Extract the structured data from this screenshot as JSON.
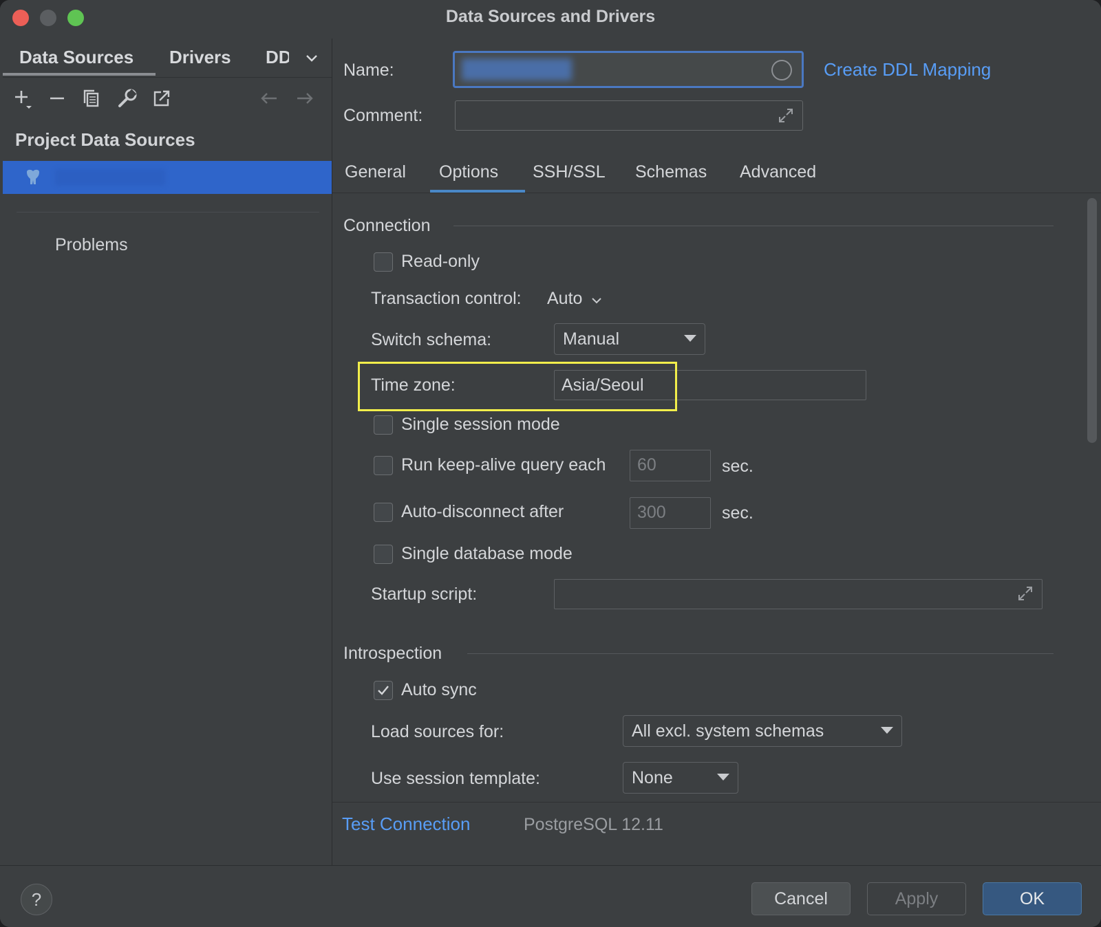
{
  "window": {
    "title": "Data Sources and Drivers"
  },
  "sidebar": {
    "tabs": [
      "Data Sources",
      "Drivers",
      "DD"
    ],
    "section_title": "Project Data Sources",
    "problems_label": "Problems"
  },
  "form": {
    "name_label": "Name:",
    "comment_label": "Comment:",
    "ddl_link": "Create DDL Mapping"
  },
  "tabs": [
    "General",
    "Options",
    "SSH/SSL",
    "Schemas",
    "Advanced"
  ],
  "connection": {
    "title": "Connection",
    "read_only": "Read-only",
    "transaction_label": "Transaction control:",
    "transaction_value": "Auto",
    "switch_schema_label": "Switch schema:",
    "switch_schema_value": "Manual",
    "time_zone_label": "Time zone:",
    "time_zone_value": "Asia/Seoul",
    "single_session": "Single session mode",
    "keep_alive": "Run keep-alive query each",
    "keep_alive_value": "60",
    "auto_disconnect": "Auto-disconnect after",
    "auto_disconnect_value": "300",
    "sec": "sec.",
    "single_db": "Single database mode",
    "startup_label": "Startup script:"
  },
  "introspection": {
    "title": "Introspection",
    "auto_sync": "Auto sync",
    "load_sources_label": "Load sources for:",
    "load_sources_value": "All excl. system schemas",
    "session_template_label": "Use session template:",
    "session_template_value": "None"
  },
  "status": {
    "test_connection": "Test Connection",
    "server_version": "PostgreSQL 12.11"
  },
  "buttons": {
    "help": "?",
    "cancel": "Cancel",
    "apply": "Apply",
    "ok": "OK"
  },
  "colors": {
    "accent_link": "#589df6",
    "selection": "#2f65ca",
    "highlight": "#f2ee4b",
    "primary_button": "#365880"
  }
}
